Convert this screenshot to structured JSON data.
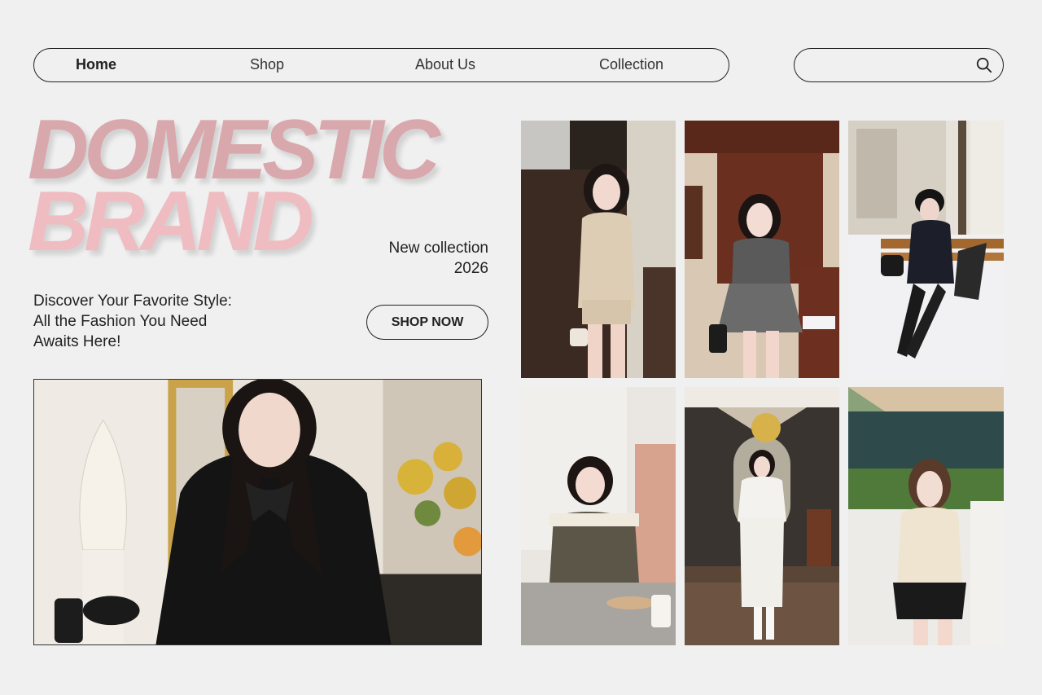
{
  "nav": {
    "items": [
      {
        "label": "Home",
        "active": true
      },
      {
        "label": "Shop",
        "active": false
      },
      {
        "label": "About Us",
        "active": false
      },
      {
        "label": "Collection",
        "active": false
      }
    ]
  },
  "search": {
    "placeholder": "",
    "value": "",
    "icon": "search-icon"
  },
  "hero": {
    "title_line1": "DOMESTIC",
    "title_line2": "BRAND",
    "title_colors": [
      "#d9a8ad",
      "#efbcc1"
    ],
    "collection_line1": "New collection",
    "collection_line2": "2026",
    "tagline_line1": "Discover Your Favorite Style:",
    "tagline_line2": "All the Fashion You Need",
    "tagline_line3": "Awaits Here!",
    "cta_label": "SHOP NOW"
  },
  "colors": {
    "background": "#f0f0f0",
    "text": "#222222"
  }
}
